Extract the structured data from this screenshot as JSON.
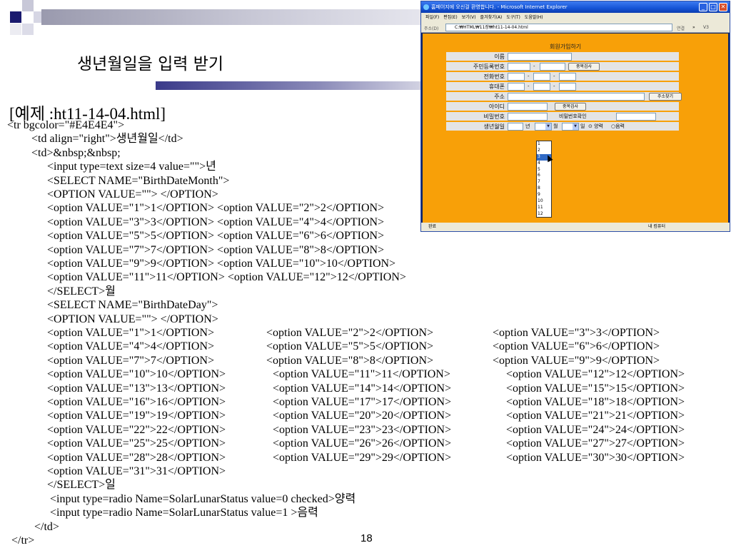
{
  "slide": {
    "title": "생년월일을 입력 받기",
    "example_title": "[예제 :ht11-14-04.html]",
    "page_number": "18"
  },
  "code_lines": [
    [
      "<tr bgcolor=\"#E4E4E4\">"
    ],
    [
      "<td align=\"right\">생년월일</td>"
    ],
    [
      "<td>&nbsp;&nbsp;"
    ],
    [
      "<input type=text size=4 value=\"\">년"
    ],
    [
      "<SELECT NAME=\"BirthDateMonth\">"
    ],
    [
      "<OPTION VALUE=\"\"> </OPTION>"
    ],
    [
      "<option VALUE=\"1\">1</OPTION> <option VALUE=\"2\">2</OPTION>"
    ],
    [
      "<option VALUE=\"3\">3</OPTION> <option VALUE=\"4\">4</OPTION>"
    ],
    [
      "<option VALUE=\"5\">5</OPTION> <option VALUE=\"6\">6</OPTION>"
    ],
    [
      "<option VALUE=\"7\">7</OPTION> <option VALUE=\"8\">8</OPTION>"
    ],
    [
      "<option VALUE=\"9\">9</OPTION> <option VALUE=\"10\">10</OPTION>"
    ],
    [
      "<option VALUE=\"11\">11</OPTION> <option VALUE=\"12\">12</OPTION>"
    ],
    [
      "</SELECT>월"
    ],
    [
      "<SELECT NAME=\"BirthDateDay\">"
    ],
    [
      "<OPTION VALUE=\"\"> </OPTION>"
    ],
    [
      "<option VALUE=\"1\">1</OPTION>",
      "<option VALUE=\"2\">2</OPTION>",
      "<option VALUE=\"3\">3</OPTION>"
    ],
    [
      "<option VALUE=\"4\">4</OPTION>",
      "<option VALUE=\"5\">5</OPTION>",
      "<option VALUE=\"6\">6</OPTION>"
    ],
    [
      "<option VALUE=\"7\">7</OPTION>",
      "<option VALUE=\"8\">8</OPTION>",
      "<option VALUE=\"9\">9</OPTION>"
    ],
    [
      "<option VALUE=\"10\">10</OPTION>",
      "<option VALUE=\"11\">11</OPTION>",
      "<option VALUE=\"12\">12</OPTION>"
    ],
    [
      "<option VALUE=\"13\">13</OPTION>",
      "<option VALUE=\"14\">14</OPTION>",
      "<option VALUE=\"15\">15</OPTION>"
    ],
    [
      "<option VALUE=\"16\">16</OPTION>",
      "<option VALUE=\"17\">17</OPTION>",
      "<option VALUE=\"18\">18</OPTION>"
    ],
    [
      "<option VALUE=\"19\">19</OPTION>",
      "<option VALUE=\"20\">20</OPTION>",
      "<option VALUE=\"21\">21</OPTION>"
    ],
    [
      "<option VALUE=\"22\">22</OPTION>",
      "<option VALUE=\"23\">23</OPTION>",
      "<option VALUE=\"24\">24</OPTION>"
    ],
    [
      "<option VALUE=\"25\">25</OPTION>",
      "<option VALUE=\"26\">26</OPTION>",
      "<option VALUE=\"27\">27</OPTION>"
    ],
    [
      "<option VALUE=\"28\">28</OPTION>",
      "<option VALUE=\"29\">29</OPTION>",
      "<option VALUE=\"30\">30</OPTION>"
    ],
    [
      "<option VALUE=\"31\">31</OPTION>"
    ],
    [
      "</SELECT>일"
    ],
    [
      "<input type=radio Name=SolarLunarStatus value=0 checked>양력"
    ],
    [
      "<input type=radio Name=SolarLunarStatus value=1 >음력"
    ],
    [
      "</td>"
    ],
    [
      "</tr>"
    ]
  ],
  "browser": {
    "title": "홈페이지에 오신걸 환영합니다. - Microsoft Internet Explorer",
    "menu": [
      "파일(F)",
      "편집(E)",
      "보기(V)",
      "즐겨찾기(A)",
      "도구(T)",
      "도움말(H)"
    ],
    "address_label": "주소(D)",
    "address": "C:₩HTML₩11장₩ht11-14-04.html",
    "go_label": "연결",
    "status_left": "완료",
    "status_right": "내 컴퓨터",
    "form": {
      "heading": "회원가입하기",
      "labels": [
        "이름",
        "주민등록번호",
        "전화번호",
        "휴대폰",
        "주소",
        "아이디",
        "비밀번호",
        "생년월일"
      ],
      "dup_check": "중복검사",
      "addr_search": "주소찾기",
      "id_check": "중복검사",
      "pw_confirm": "비밀번호확인",
      "dash": "-",
      "year_suffix": "년",
      "month_suffix": "월",
      "day_suffix": "일",
      "solar": "양력",
      "lunar": "음력",
      "month_options": [
        "1",
        "2",
        "3",
        "4",
        "5",
        "6",
        "7",
        "8",
        "9",
        "10",
        "11",
        "12"
      ],
      "highlighted_month": "3"
    }
  }
}
